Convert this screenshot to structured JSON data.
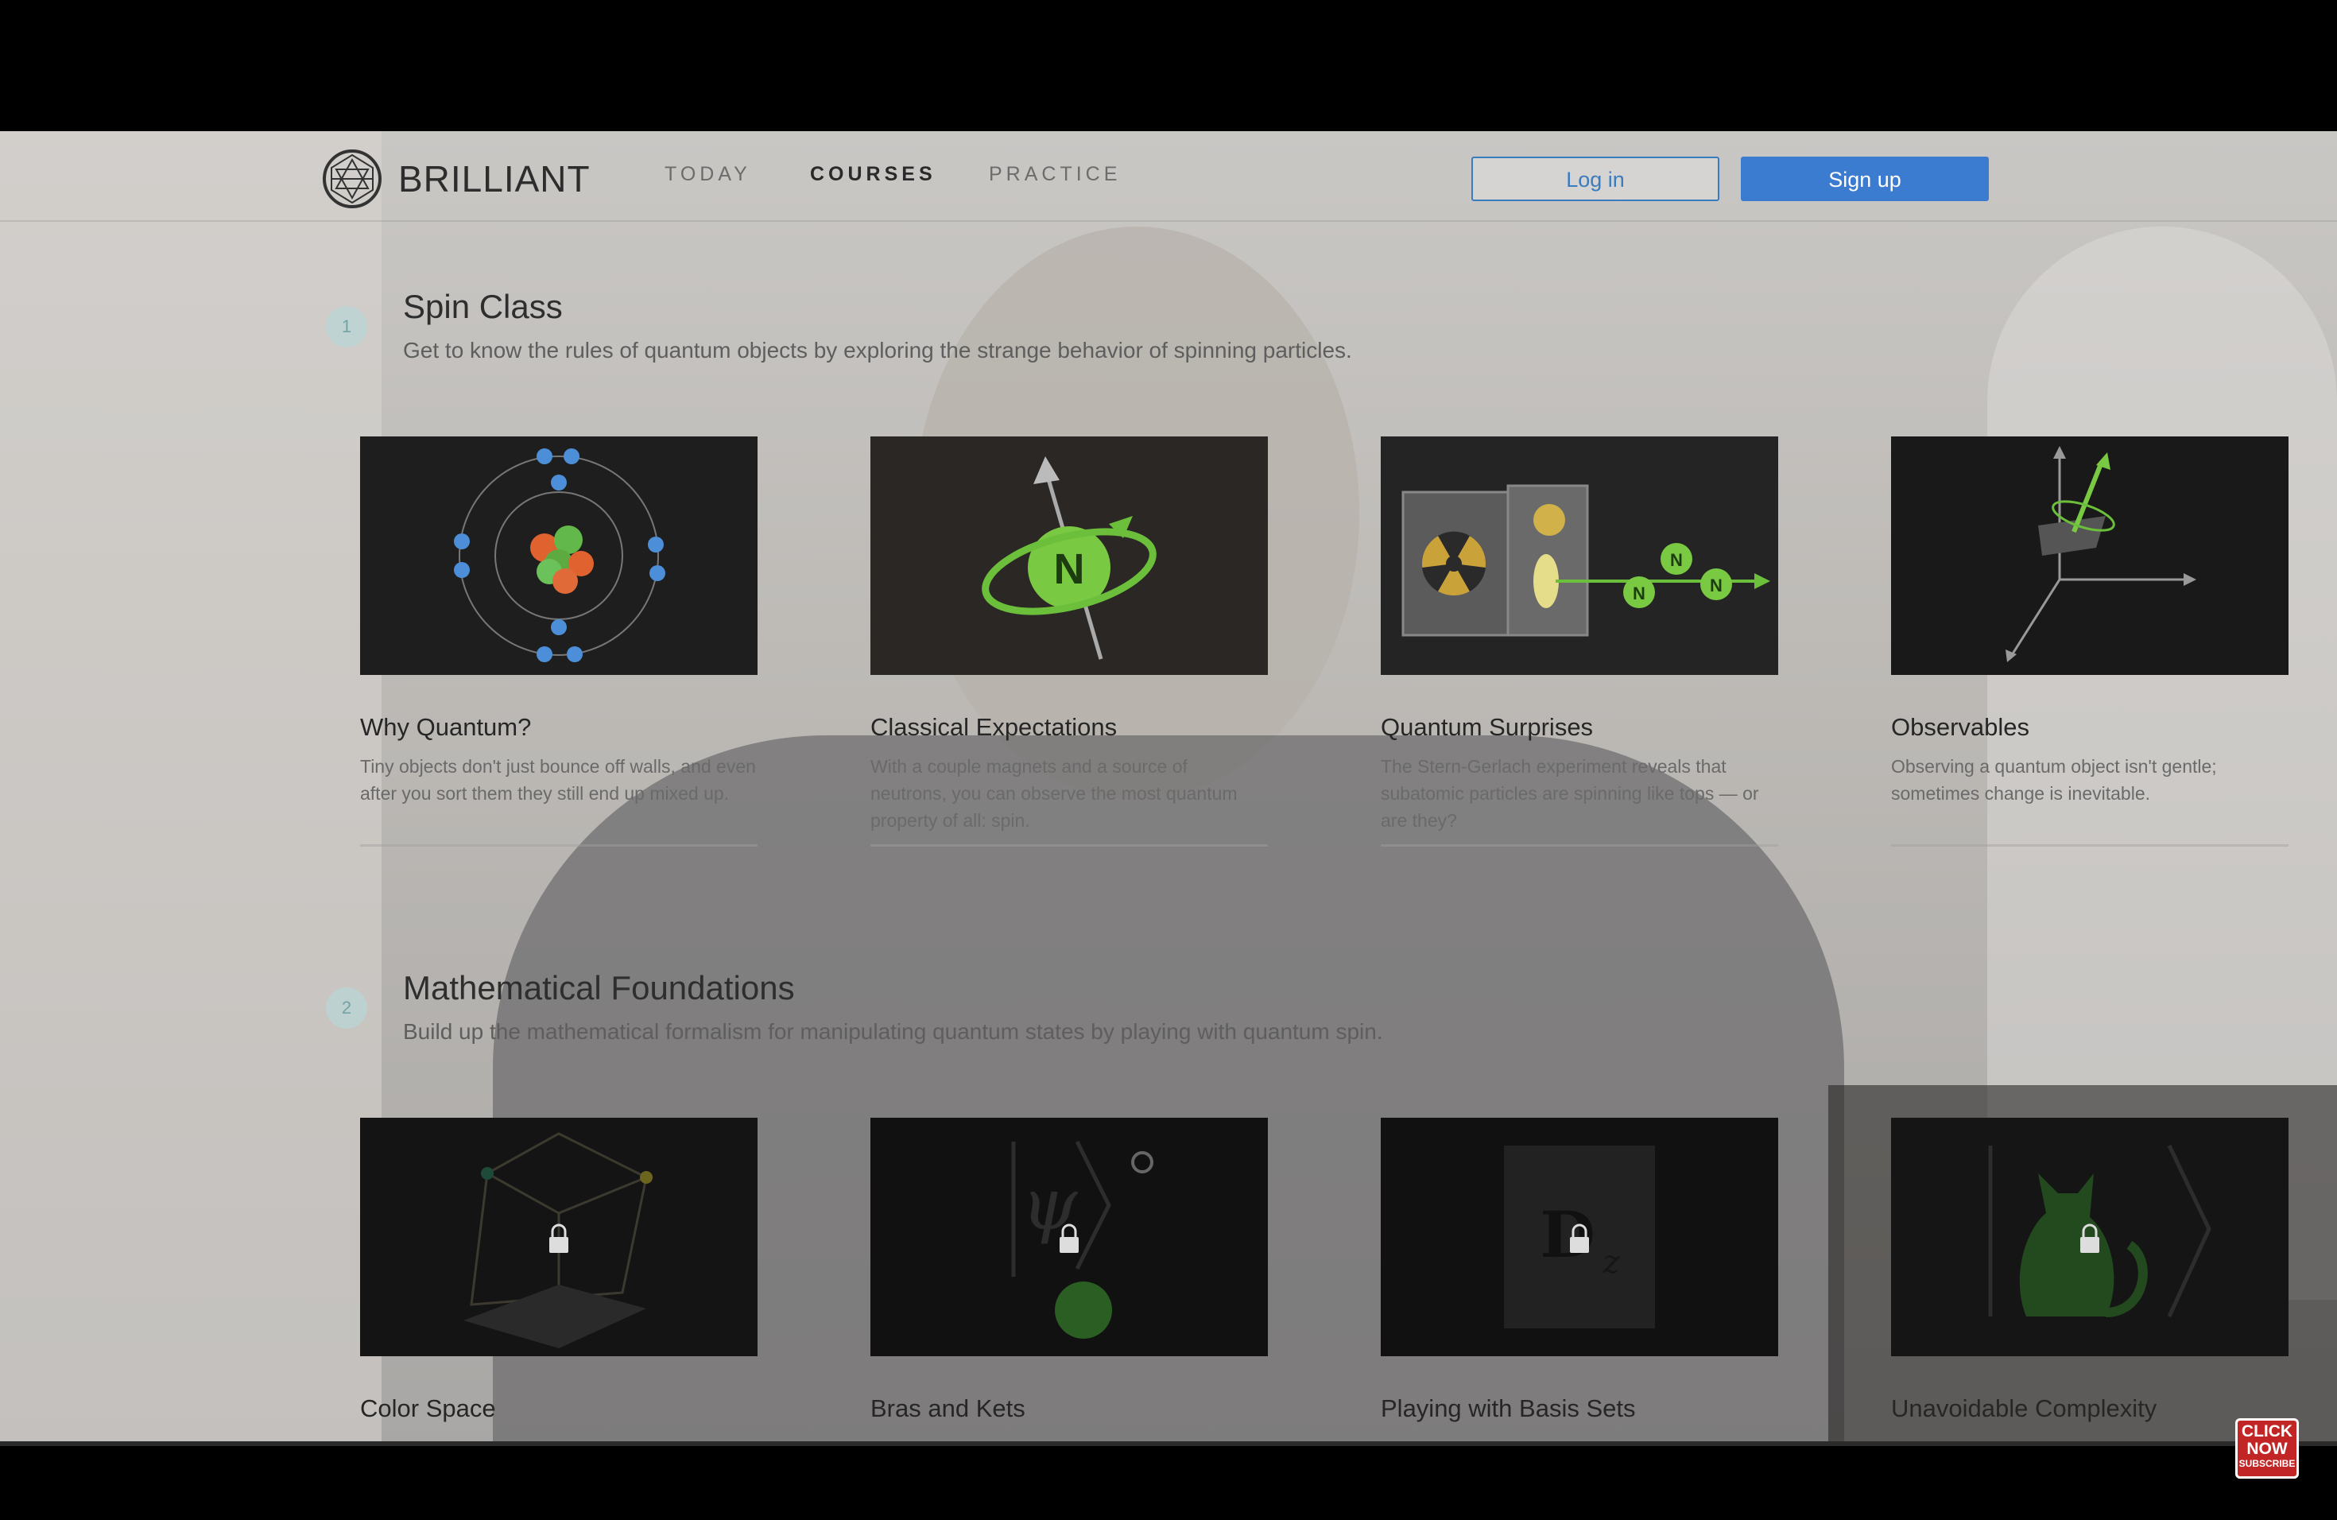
{
  "nav": {
    "brand": "BRILLIANT",
    "links": [
      {
        "label": "TODAY",
        "active": false
      },
      {
        "label": "COURSES",
        "active": true
      },
      {
        "label": "PRACTICE",
        "active": false
      }
    ],
    "login_label": "Log in",
    "signup_label": "Sign up"
  },
  "sections": [
    {
      "number": "1",
      "title": "Spin Class",
      "description": "Get to know the rules of quantum objects by exploring the strange behavior of spinning particles.",
      "cards": [
        {
          "title": "Why Quantum?",
          "description": "Tiny objects don't just bounce off walls, and even after you sort them they still end up mixed up.",
          "icon": "atom-icon",
          "locked": false
        },
        {
          "title": "Classical Expectations",
          "description": "With a couple magnets and a source of neutrons, you can observe the most quantum property of all: spin.",
          "icon": "spinning-neutron-icon",
          "locked": false
        },
        {
          "title": "Quantum Surprises",
          "description": "The Stern-Gerlach experiment reveals that subatomic particles are spinning like tops — or are they?",
          "icon": "stern-gerlach-icon",
          "locked": false
        },
        {
          "title": "Observables",
          "description": "Observing a quantum object isn't gentle; sometimes change is inevitable.",
          "icon": "axes-spin-icon",
          "locked": false
        }
      ]
    },
    {
      "number": "2",
      "title": "Mathematical Foundations",
      "description": "Build up the mathematical formalism for manipulating quantum states by playing with quantum spin.",
      "cards": [
        {
          "title": "Color Space",
          "description": "",
          "icon": "color-cube-icon",
          "locked": true
        },
        {
          "title": "Bras and Kets",
          "description": "",
          "icon": "bra-ket-icon",
          "locked": true
        },
        {
          "title": "Playing with Basis Sets",
          "description": "",
          "icon": "basis-matrix-icon",
          "locked": true
        },
        {
          "title": "Unavoidable Complexity",
          "description": "",
          "icon": "cat-icon",
          "locked": true
        }
      ]
    }
  ],
  "subscribe_badge": {
    "line1": "CLICK",
    "line2": "NOW",
    "line3": "SUBSCRIBE"
  },
  "colors": {
    "accent": "#3b7bd0",
    "section_badge": "#b8d6d6",
    "card_bg": "#1c1c1c"
  }
}
